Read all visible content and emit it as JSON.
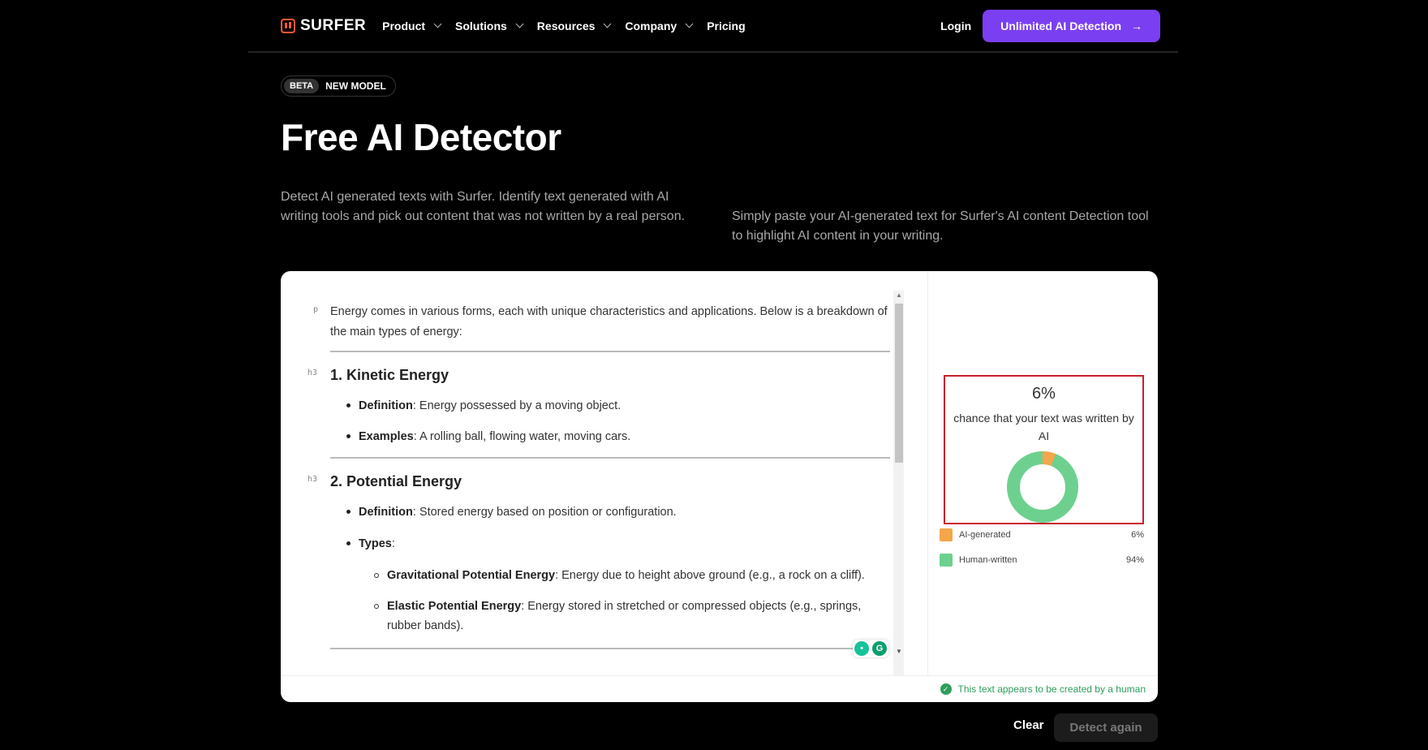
{
  "nav": {
    "logo": "SURFER",
    "items": [
      {
        "label": "Product",
        "has_dropdown": true
      },
      {
        "label": "Solutions",
        "has_dropdown": true
      },
      {
        "label": "Resources",
        "has_dropdown": true
      },
      {
        "label": "Company",
        "has_dropdown": true
      },
      {
        "label": "Pricing",
        "has_dropdown": false
      }
    ],
    "login": "Login",
    "cta": "Unlimited AI Detection",
    "cta_color": "#7b3ff2"
  },
  "badge": {
    "beta": "BETA",
    "label": "NEW MODEL"
  },
  "hero": {
    "title": "Free AI Detector",
    "desc_left": "Detect AI generated texts with Surfer. Identify text generated with AI writing tools and pick out content that was not written by a real person.",
    "desc_right": "Simply paste your AI-generated text for Surfer's AI content Detection tool to highlight AI content in your writing."
  },
  "editor": {
    "tags": {
      "p": "p",
      "h3": "h3"
    },
    "intro": "Energy comes in various forms, each with unique characteristics and applications. Below is a breakdown of the main types of energy:",
    "sections": [
      {
        "heading": "1. Kinetic Energy",
        "items": [
          {
            "term": "Definition",
            "text": ": Energy possessed by a moving object."
          },
          {
            "term": "Examples",
            "text": ": A rolling ball, flowing water, moving cars."
          }
        ]
      },
      {
        "heading": "2. Potential Energy",
        "items": [
          {
            "term": "Definition",
            "text": ": Stored energy based on position or configuration."
          },
          {
            "term": "Types",
            "text": ":"
          }
        ],
        "subitems": [
          {
            "term": "Gravitational Potential Energy",
            "text": ": Energy due to height above ground (e.g., a rock on a cliff)."
          },
          {
            "term": "Elastic Potential Energy",
            "text": ": Energy stored in stretched or compressed objects (e.g., springs, rubber bands)."
          }
        ]
      }
    ]
  },
  "result": {
    "percent": "6%",
    "chance_text": "chance that your text was written by AI",
    "ai_fraction": 0.06,
    "legend": [
      {
        "label": "AI-generated",
        "value": "6%",
        "color": "#f5a54a"
      },
      {
        "label": "Human-written",
        "value": "94%",
        "color": "#6dd08f"
      }
    ],
    "footer": "This text appears to be created by a human"
  },
  "actions": {
    "clear": "Clear",
    "detect": "Detect again"
  }
}
